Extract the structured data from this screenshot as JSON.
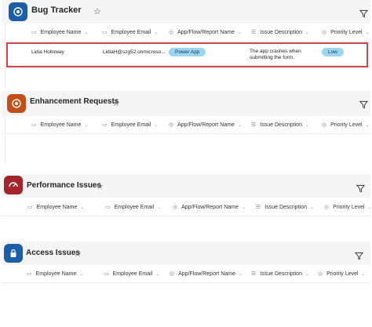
{
  "columns": [
    "Employee Name",
    "Employee Email",
    "App/Flow/Report Name",
    "Issue Description",
    "Priority Level"
  ],
  "colors": {
    "bug_icon": "#1c5fa8",
    "enhancement_icon": "#c24f15",
    "performance_icon": "#a4262c",
    "access_icon": "#1c5fa8",
    "selection_border": "#d9414a",
    "pill_bg": "#9cd5ef"
  },
  "lists": [
    {
      "title": "Bug Tracker",
      "rows": [
        {
          "name": "Lidia Holloway",
          "email": "LidiaH@szg52.onmicroso...",
          "app": "Power App",
          "issue_line1": "The app crashes when",
          "issue_line2": "submitting the form.",
          "priority": "Low"
        }
      ]
    },
    {
      "title": "Enhancement Requests",
      "rows": []
    },
    {
      "title": "Performance Issues",
      "rows": []
    },
    {
      "title": "Access Issues",
      "rows": []
    }
  ]
}
